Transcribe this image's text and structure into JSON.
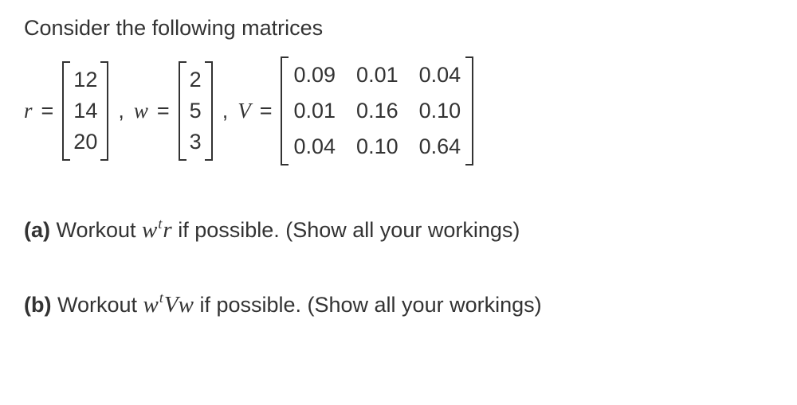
{
  "intro": "Consider the following matrices",
  "vars": {
    "r_name": "r",
    "w_name": "w",
    "V_name": "V",
    "eq": "="
  },
  "r": [
    "12",
    "14",
    "20"
  ],
  "w": [
    "2",
    "5",
    "3"
  ],
  "V": [
    [
      "0.09",
      "0.01",
      "0.04"
    ],
    [
      "0.01",
      "0.16",
      "0.10"
    ],
    [
      "0.04",
      "0.10",
      "0.64"
    ]
  ],
  "comma": ",",
  "questions": {
    "a": {
      "label": "(a)",
      "pre": " Workout ",
      "expr_w": "w",
      "expr_sup": "t",
      "expr_r": "r",
      "post": "  if possible. (Show all your workings)"
    },
    "b": {
      "label": "(b)",
      "pre": " Workout  ",
      "expr_w": "w",
      "expr_sup": "t",
      "expr_V": "V",
      "expr_w2": "w",
      "post": " if possible. (Show all your workings)"
    }
  }
}
